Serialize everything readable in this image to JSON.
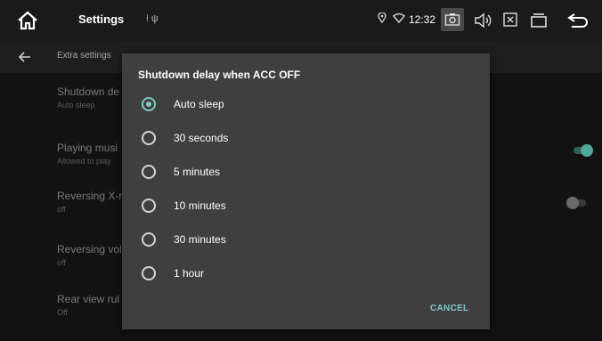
{
  "statusbar": {
    "app_title": "Settings",
    "indicators": "⍿ ψ",
    "time": "12:32",
    "icons": [
      "home-icon",
      "location-icon",
      "wifi-icon",
      "screenshot-icon",
      "volume-icon",
      "close-box-icon",
      "recent-apps-icon",
      "back-icon"
    ]
  },
  "toolbar": {
    "title": "Extra settings"
  },
  "settings_rows": [
    {
      "title": "Shutdown de",
      "subtitle": "Auto sleep"
    },
    {
      "title": "Playing musi",
      "subtitle": "Allowed to play"
    },
    {
      "title": "Reversing X-r",
      "subtitle": "off"
    },
    {
      "title": "Reversing vol",
      "subtitle": "off"
    },
    {
      "title": "Rear view rul",
      "subtitle": "Off"
    }
  ],
  "toggles": {
    "playing_music": true,
    "reversing_xray": false
  },
  "dialog": {
    "title": "Shutdown delay when ACC OFF",
    "options": [
      "Auto sleep",
      "30 seconds",
      "5 minutes",
      "10 minutes",
      "30 minutes",
      "1 hour"
    ],
    "selected": "Auto sleep",
    "cancel_label": "CANCEL"
  },
  "colors": {
    "accent": "#80cbc4",
    "dialog_bg": "#3f3f3f",
    "statusbar_bg": "#1a1a1a"
  }
}
